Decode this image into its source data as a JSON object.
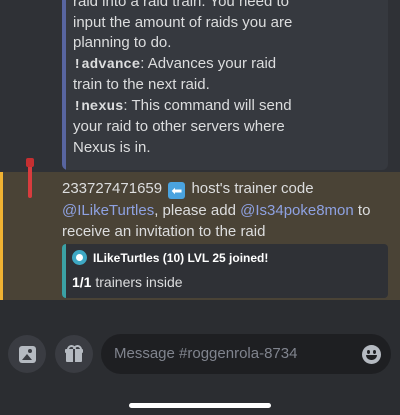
{
  "top_embed": {
    "line1": "raid into a raid train. You need to",
    "line2": "input the amount of raids you are",
    "line3": "planning to do.",
    "advance_cmd": "!advance",
    "advance_desc": ": Advances your raid",
    "advance_desc2": "train to the next raid.",
    "nexus_cmd": "!nexus",
    "nexus_desc": ": This command will send",
    "nexus_desc2": "your raid to other servers where",
    "nexus_desc3": "Nexus is in."
  },
  "message": {
    "code": "233727471659",
    "arrow_emoji": "⬅",
    "code_suffix": " host's trainer code",
    "mention_user": "@ILikeTurtles",
    "please_add": ", please add ",
    "mention_friend": "@Is34poke8mon",
    "to": " to",
    "line3": "receive an invitation to the raid"
  },
  "embed": {
    "author": "ILikeTurtles (10) LVL 25 joined!",
    "count": "1/1",
    "count_suffix": " trainers inside"
  },
  "composer": {
    "placeholder": "Message #roggenrola-8734"
  },
  "colors": {
    "highlight_bg": "#4a4336",
    "highlight_bar": "#f0b232",
    "mention": "#8ea1e1",
    "embed_stripe": "#5865a0",
    "small_embed_stripe": "#3ba1a4"
  },
  "icons": [
    "image-icon",
    "gift-icon",
    "emoji-icon",
    "pin-flag-icon",
    "embed-author-icon",
    "left-arrow-emoji"
  ]
}
